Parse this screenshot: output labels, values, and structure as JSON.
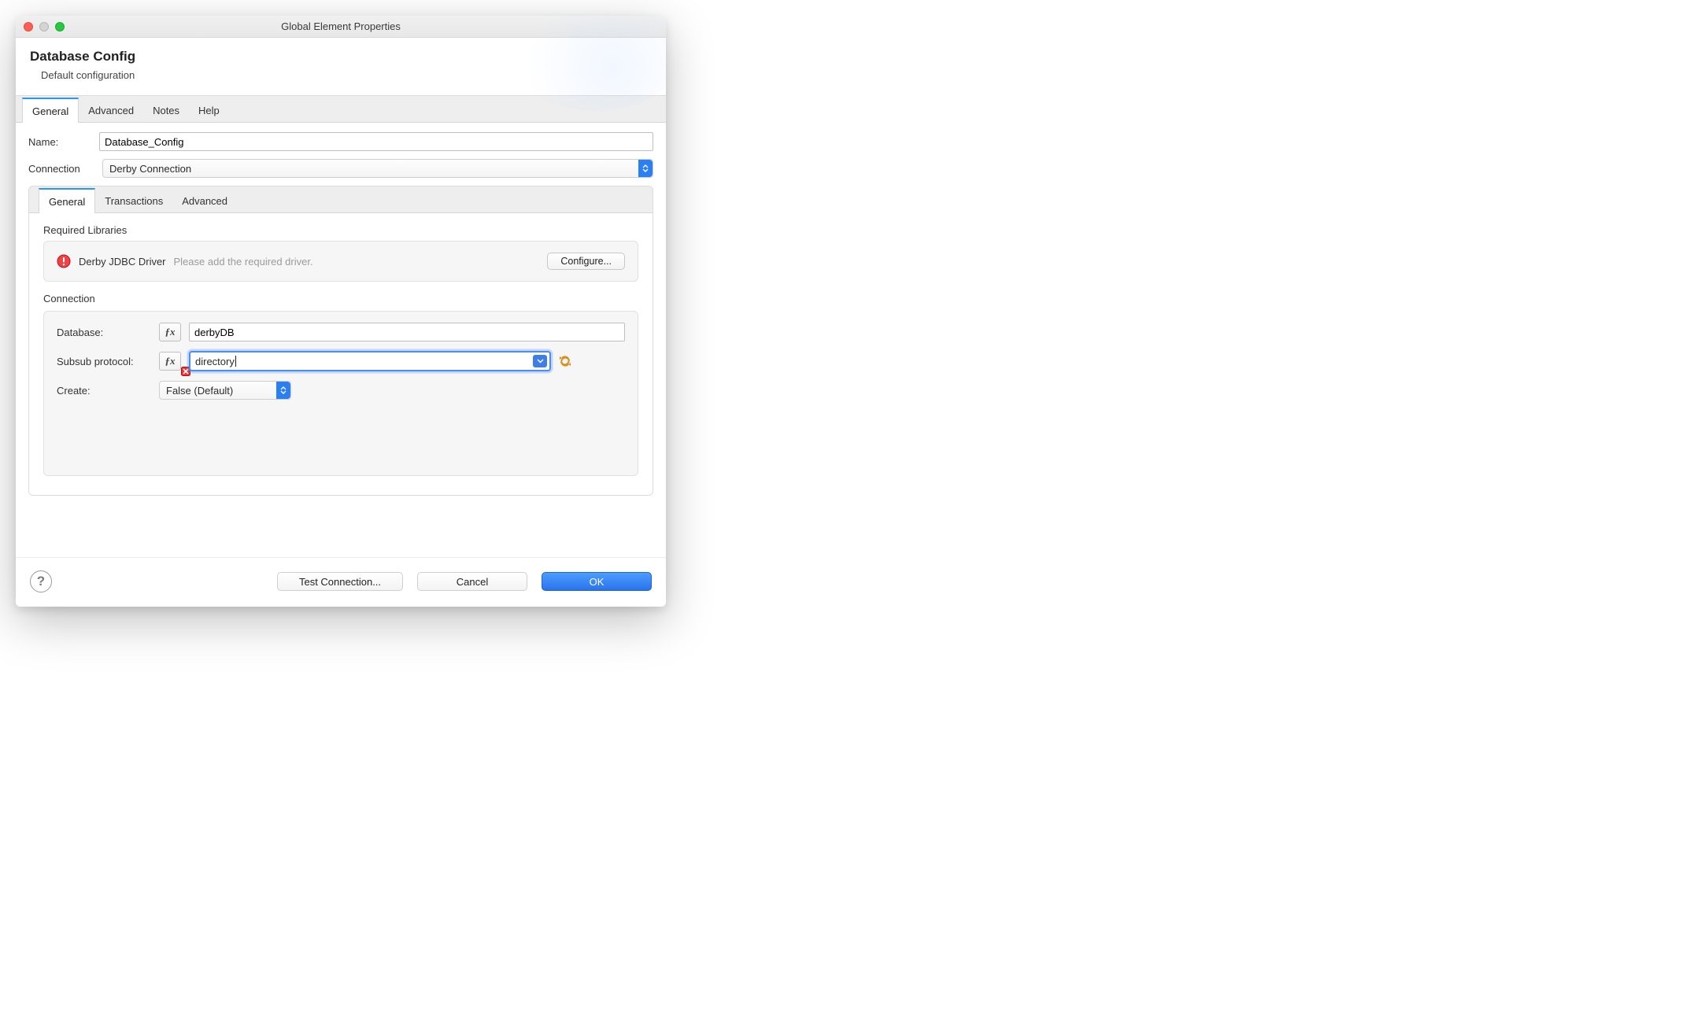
{
  "window": {
    "title": "Global Element Properties"
  },
  "header": {
    "title": "Database Config",
    "subtitle": "Default configuration"
  },
  "outer_tabs": [
    "General",
    "Advanced",
    "Notes",
    "Help"
  ],
  "outer_active": 0,
  "name_field": {
    "label": "Name:",
    "value": "Database_Config"
  },
  "connection_field": {
    "label": "Connection",
    "value": "Derby Connection"
  },
  "inner_tabs": [
    "General",
    "Transactions",
    "Advanced"
  ],
  "inner_active": 0,
  "libraries": {
    "section_label": "Required Libraries",
    "driver_name": "Derby JDBC Driver",
    "hint": "Please add the required driver.",
    "configure_btn": "Configure..."
  },
  "connection_section": {
    "section_label": "Connection",
    "database": {
      "label": "Database:",
      "value": "derbyDB"
    },
    "subsub": {
      "label": "Subsub protocol:",
      "value": "directory"
    },
    "create": {
      "label": "Create:",
      "value": "False (Default)"
    }
  },
  "buttons": {
    "test": "Test Connection...",
    "cancel": "Cancel",
    "ok": "OK"
  }
}
